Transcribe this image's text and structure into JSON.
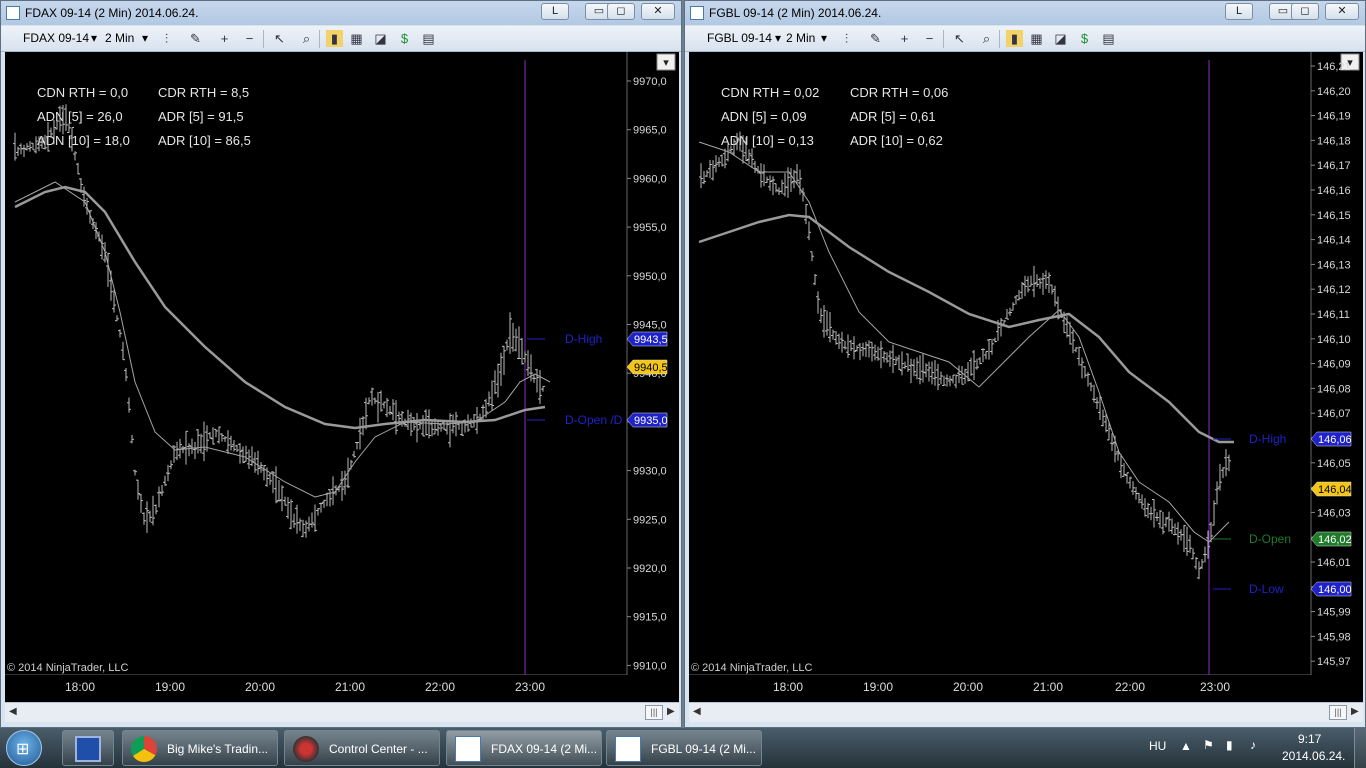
{
  "windows": [
    {
      "title": "FDAX 09-14 (2 Min)  2014.06.24.",
      "buttons": {
        "link": "L",
        "minimize": "▭",
        "maximize": "◻",
        "close": "✕"
      },
      "toolbar": {
        "instrument": "FDAX 09-14",
        "interval": "2 Min"
      },
      "stats": {
        "left": [
          "CDN RTH = 0,0",
          "ADN [5] = 26,0",
          "ADN [10] = 18,0"
        ],
        "right": [
          "CDR RTH = 8,5",
          "ADR [5] = 91,5",
          "ADR [10] = 86,5"
        ]
      },
      "copyright": "© 2014 NinjaTrader, LLC",
      "time_labels": [
        "18:00",
        "19:00",
        "20:00",
        "21:00",
        "22:00",
        "23:00"
      ],
      "price_ticks": [
        "9970,0",
        "9965,0",
        "9960,0",
        "9955,0",
        "9950,0",
        "9945,0",
        "9940,0",
        "9935,0",
        "9930,0",
        "9925,0",
        "9920,0",
        "9915,0",
        "9910,0"
      ],
      "markers": [
        {
          "label": "D-High",
          "value": "9943,5",
          "color": "#1e22c8"
        },
        {
          "label": "",
          "value": "9940,5",
          "color": "#f2c516"
        },
        {
          "label": "D-Open /D",
          "value": "9935,0",
          "color": "#1e22c8"
        }
      ]
    },
    {
      "title": "FGBL 09-14 (2 Min)  2014.06.24.",
      "buttons": {
        "link": "L",
        "minimize": "▭",
        "maximize": "◻",
        "close": "✕"
      },
      "toolbar": {
        "instrument": "FGBL 09-14",
        "interval": "2 Min"
      },
      "stats": {
        "left": [
          "CDN RTH = 0,02",
          "ADN [5] = 0,09",
          "ADN [10] = 0,13"
        ],
        "right": [
          "CDR RTH = 0,06",
          "ADR [5] = 0,61",
          "ADR [10] = 0,62"
        ]
      },
      "copyright": "© 2014 NinjaTrader, LLC",
      "time_labels": [
        "18:00",
        "19:00",
        "20:00",
        "21:00",
        "22:00",
        "23:00"
      ],
      "price_ticks": [
        "146,21",
        "146,20",
        "146,19",
        "146,18",
        "146,17",
        "146,16",
        "146,15",
        "146,14",
        "146,13",
        "146,12",
        "146,11",
        "146,10",
        "146,09",
        "146,08",
        "146,07",
        "146,06",
        "146,05",
        "146,04",
        "146,03",
        "146,02",
        "146,01",
        "146,00",
        "145,99",
        "145,98",
        "145,97"
      ],
      "markers": [
        {
          "label": "D-High",
          "value": "146,06",
          "color": "#1e22c8"
        },
        {
          "label": "",
          "value": "146,04",
          "color": "#f2c516"
        },
        {
          "label": "D-Open",
          "value": "146,02",
          "color": "#1f7a2a"
        },
        {
          "label": "D-Low",
          "value": "146,00",
          "color": "#1e22c8"
        }
      ]
    }
  ],
  "taskbar": {
    "items": [
      {
        "label": "Big Mike's Tradin...",
        "icon": "chrome-icon"
      },
      {
        "label": "Control Center - ...",
        "icon": "ninjatrader-icon"
      },
      {
        "label": "FDAX 09-14 (2 Mi...",
        "icon": "chart-icon"
      },
      {
        "label": "FGBL 09-14 (2 Mi...",
        "icon": "chart-icon"
      }
    ],
    "language": "HU",
    "clock_time": "9:17",
    "clock_date": "2014.06.24."
  }
}
